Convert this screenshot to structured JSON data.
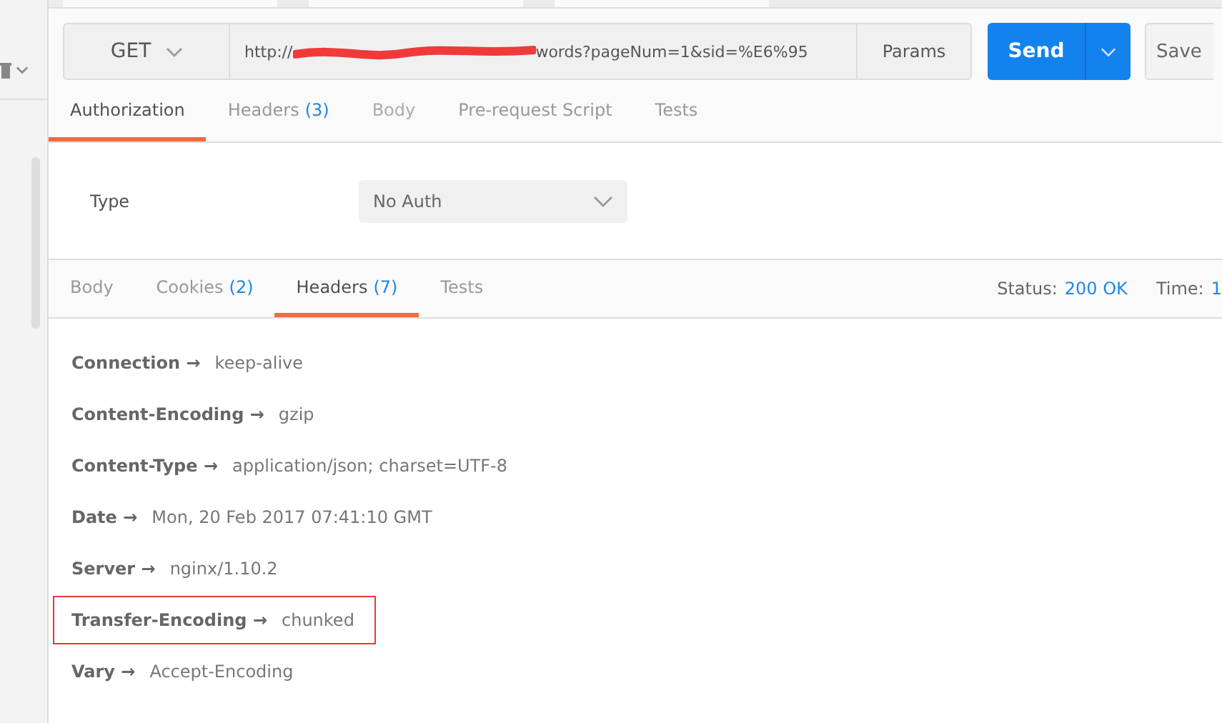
{
  "request": {
    "method": "GET",
    "url_start": "http://",
    "url_end": "words?pageNum=1&sid=%E6%95",
    "params_label": "Params",
    "send_label": "Send",
    "save_label": "Save"
  },
  "request_tabs": [
    {
      "label": "Authorization",
      "selected": true,
      "disabled": false
    },
    {
      "label": "Headers",
      "count": "(3)",
      "selected": false,
      "disabled": false
    },
    {
      "label": "Body",
      "selected": false,
      "disabled": true
    },
    {
      "label": "Pre-request Script",
      "selected": false,
      "disabled": false
    },
    {
      "label": "Tests",
      "selected": false,
      "disabled": false
    }
  ],
  "auth": {
    "type_label": "Type",
    "type_value": "No Auth"
  },
  "response_tabs": [
    {
      "label": "Body",
      "selected": false
    },
    {
      "label": "Cookies",
      "count": "(2)",
      "selected": false
    },
    {
      "label": "Headers",
      "count": "(7)",
      "selected": true
    },
    {
      "label": "Tests",
      "selected": false
    }
  ],
  "status": {
    "status_label": "Status:",
    "status_value": "200 OK",
    "time_label": "Time:",
    "time_value": "1"
  },
  "headers": [
    {
      "name": "Connection",
      "arrow": "→",
      "value": "keep-alive",
      "highlighted": false
    },
    {
      "name": "Content-Encoding",
      "arrow": "→",
      "value": "gzip",
      "highlighted": false
    },
    {
      "name": "Content-Type",
      "arrow": "→",
      "value": "application/json; charset=UTF-8",
      "highlighted": false
    },
    {
      "name": "Date",
      "arrow": "→",
      "value": "Mon, 20 Feb 2017 07:41:10 GMT",
      "highlighted": false
    },
    {
      "name": "Server",
      "arrow": "→",
      "value": "nginx/1.10.2",
      "highlighted": false
    },
    {
      "name": "Transfer-Encoding",
      "arrow": "→",
      "value": "chunked",
      "highlighted": true
    },
    {
      "name": "Vary",
      "arrow": "→",
      "value": "Accept-Encoding",
      "highlighted": false
    }
  ]
}
